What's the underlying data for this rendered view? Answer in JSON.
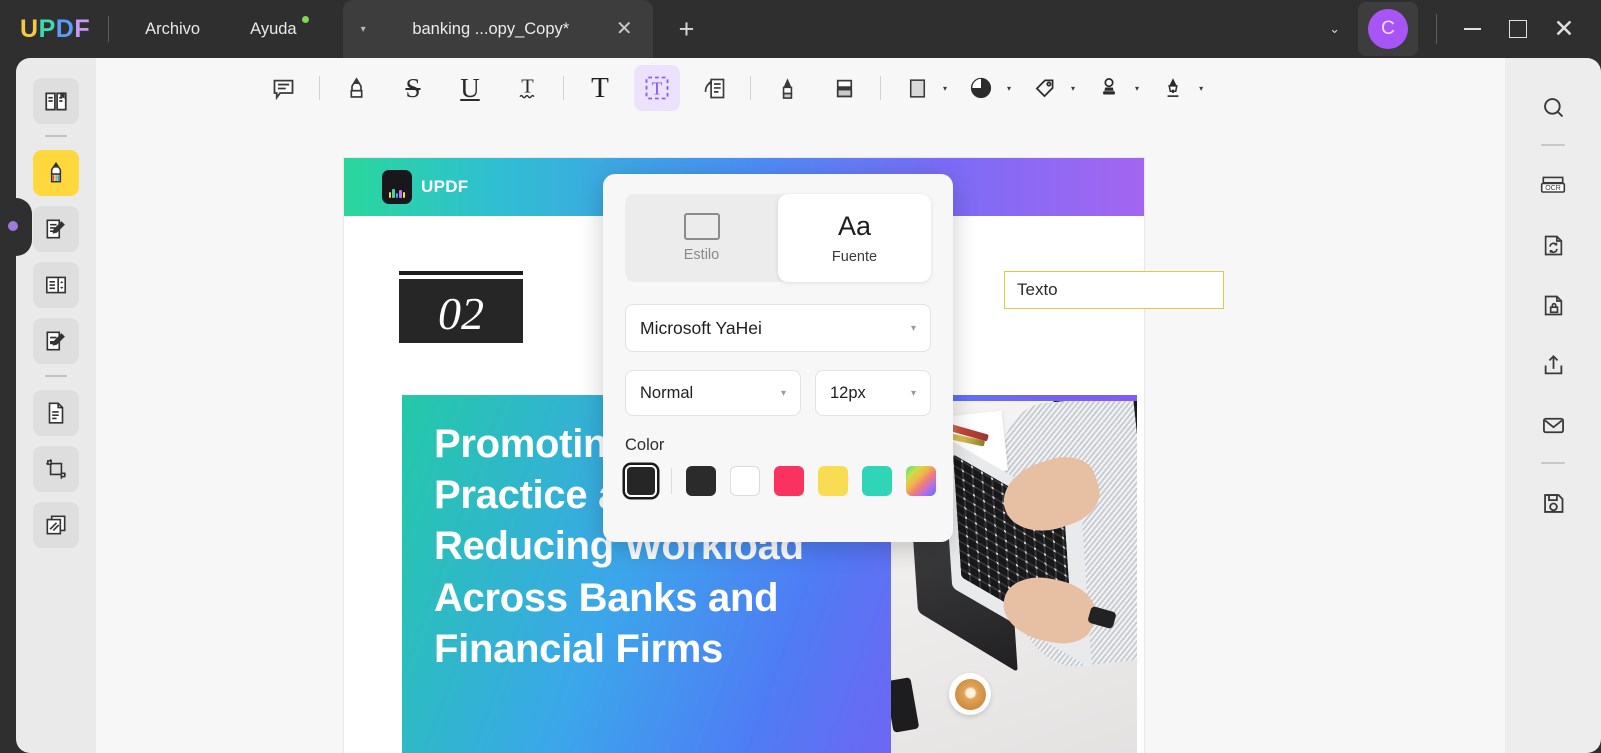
{
  "app": {
    "logo_letters": [
      "U",
      "P",
      "D",
      "F"
    ],
    "menus": [
      {
        "label": "Archivo",
        "name": "menu-archivo",
        "badge": false
      },
      {
        "label": "Ayuda",
        "name": "menu-ayuda",
        "badge": true
      }
    ],
    "tab": {
      "title": "banking ...opy_Copy*",
      "caret": "▾",
      "close": "✕",
      "new_tab": "+"
    },
    "window": {
      "chevron": "⌄",
      "avatar_initial": "C",
      "avatar_color": "#a855f7",
      "minimize": "—",
      "maximize": "□",
      "close": "✕"
    }
  },
  "left_rail": {
    "items": [
      {
        "name": "sidebar-reader-icon",
        "icon": "book-bookmark-icon",
        "active": false
      },
      {
        "name": "sidebar-annotate-icon",
        "icon": "highlighter-icon",
        "active": true
      },
      {
        "name": "sidebar-edit-icon",
        "icon": "document-pen-icon",
        "active": false
      },
      {
        "name": "sidebar-organize-icon",
        "icon": "page-organize-icon",
        "active": false
      },
      {
        "name": "sidebar-form-icon",
        "icon": "form-edit-icon",
        "active": false
      },
      {
        "name": "sidebar-convert-icon",
        "icon": "document-convert-icon",
        "active": false
      },
      {
        "name": "sidebar-crop-icon",
        "icon": "crop-icon",
        "active": false
      },
      {
        "name": "sidebar-compare-icon",
        "icon": "compare-pages-icon",
        "active": false
      }
    ]
  },
  "right_rail": {
    "items": [
      {
        "name": "search-icon",
        "icon": "search"
      },
      {
        "name": "ocr-icon",
        "icon": "ocr"
      },
      {
        "name": "convert-icon",
        "icon": "convert"
      },
      {
        "name": "protect-icon",
        "icon": "protect"
      },
      {
        "name": "share-icon",
        "icon": "share"
      },
      {
        "name": "mail-icon",
        "icon": "mail"
      },
      {
        "name": "save-icon",
        "icon": "save"
      }
    ]
  },
  "toolbar": {
    "tools": [
      {
        "name": "note-comment-tool",
        "icon": "comment-box-icon",
        "selected": false,
        "caret": false
      },
      {
        "name": "highlight-tool",
        "icon": "highlighter-icon",
        "selected": false,
        "caret": false
      },
      {
        "name": "strikethrough-tool",
        "icon": "strikethrough-S-icon",
        "selected": false,
        "caret": false
      },
      {
        "name": "underline-tool",
        "icon": "underline-U-icon",
        "selected": false,
        "caret": false
      },
      {
        "name": "squiggly-tool",
        "icon": "squiggly-T-icon",
        "selected": false,
        "caret": false
      },
      {
        "name": "text-tool",
        "icon": "text-T-icon",
        "selected": false,
        "caret": false
      },
      {
        "name": "text-box-tool",
        "icon": "text-box-T-icon",
        "selected": true,
        "caret": false
      },
      {
        "name": "callout-tool",
        "icon": "callout-icon",
        "selected": false,
        "caret": false
      },
      {
        "name": "pencil-tool",
        "icon": "pencil-icon",
        "selected": false,
        "caret": false
      },
      {
        "name": "eraser-tool",
        "icon": "eraser-icon",
        "selected": false,
        "caret": false
      },
      {
        "name": "shape-tool",
        "icon": "square-shape-icon",
        "selected": false,
        "caret": true
      },
      {
        "name": "sticker-tool",
        "icon": "sticker-circle-icon",
        "selected": false,
        "caret": true
      },
      {
        "name": "tag-tool",
        "icon": "tag-icon",
        "selected": false,
        "caret": true
      },
      {
        "name": "stamp-tool",
        "icon": "stamp-icon",
        "selected": false,
        "caret": true
      },
      {
        "name": "signature-tool",
        "icon": "fountain-pen-icon",
        "selected": false,
        "caret": true
      }
    ]
  },
  "popup": {
    "tabs": [
      {
        "label": "Estilo",
        "name": "tab-estilo",
        "active": false,
        "icon": "rectangle-icon"
      },
      {
        "label": "Fuente",
        "name": "tab-fuente",
        "active": true,
        "icon": "Aa"
      }
    ],
    "font_family": "Microsoft YaHei",
    "font_style": "Normal",
    "font_size": "12px",
    "color_label": "Color",
    "caret": "▾",
    "swatches": [
      {
        "name": "swatch-current",
        "hex": "#262626",
        "current": true
      },
      {
        "name": "swatch-black",
        "hex": "#2b2b2b",
        "current": false
      },
      {
        "name": "swatch-white",
        "hex": "#ffffff",
        "current": false
      },
      {
        "name": "swatch-pink",
        "hex": "#f9325f",
        "current": false
      },
      {
        "name": "swatch-yellow",
        "hex": "#f8dc52",
        "current": false
      },
      {
        "name": "swatch-teal",
        "hex": "#30d5b8",
        "current": false
      },
      {
        "name": "swatch-rainbow",
        "hex": "rainbow",
        "current": false
      }
    ]
  },
  "document": {
    "banner_brand": "UPDF",
    "section_number": "02",
    "text_box_value": "Texto",
    "hero_heading": "Promoting Best Practice and Reducing Workload Across Banks and Financial Firms"
  }
}
